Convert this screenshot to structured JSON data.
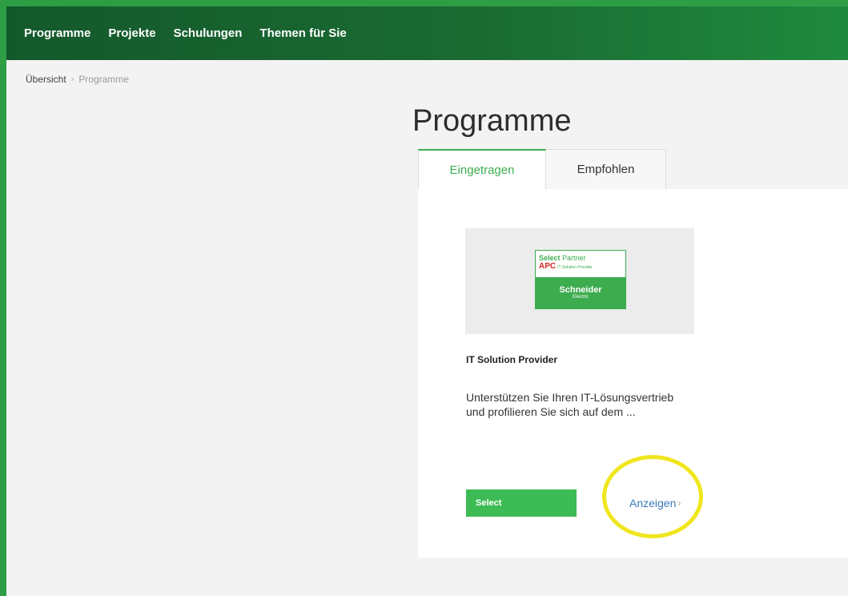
{
  "nav": {
    "items": [
      {
        "label": "Programme"
      },
      {
        "label": "Projekte"
      },
      {
        "label": "Schulungen"
      },
      {
        "label": "Themen für Sie"
      }
    ]
  },
  "breadcrumb": {
    "home": "Übersicht",
    "separator": "›",
    "current": "Programme"
  },
  "page": {
    "title": "Programme"
  },
  "tabs": [
    {
      "label": "Eingetragen",
      "active": true
    },
    {
      "label": "Empfohlen",
      "active": false
    }
  ],
  "card": {
    "logo": {
      "line1_bold": "Select",
      "line1_rest": " Partner",
      "brand": "APC",
      "brand_sub": "IT Solution Provider",
      "company": "Schneider",
      "company_sub": "Electric"
    },
    "title": "IT Solution Provider",
    "description": "Unterstützen Sie Ihren IT-Lösungsvertrieb und profilieren Sie sich auf dem ...",
    "level_button": "Select",
    "show_link": "Anzeigen",
    "show_chevron": "›"
  },
  "colors": {
    "accent": "#3dac4f",
    "nav_bg": "#1a6a32",
    "link": "#3a7ab5",
    "highlight": "#f0e61e"
  }
}
